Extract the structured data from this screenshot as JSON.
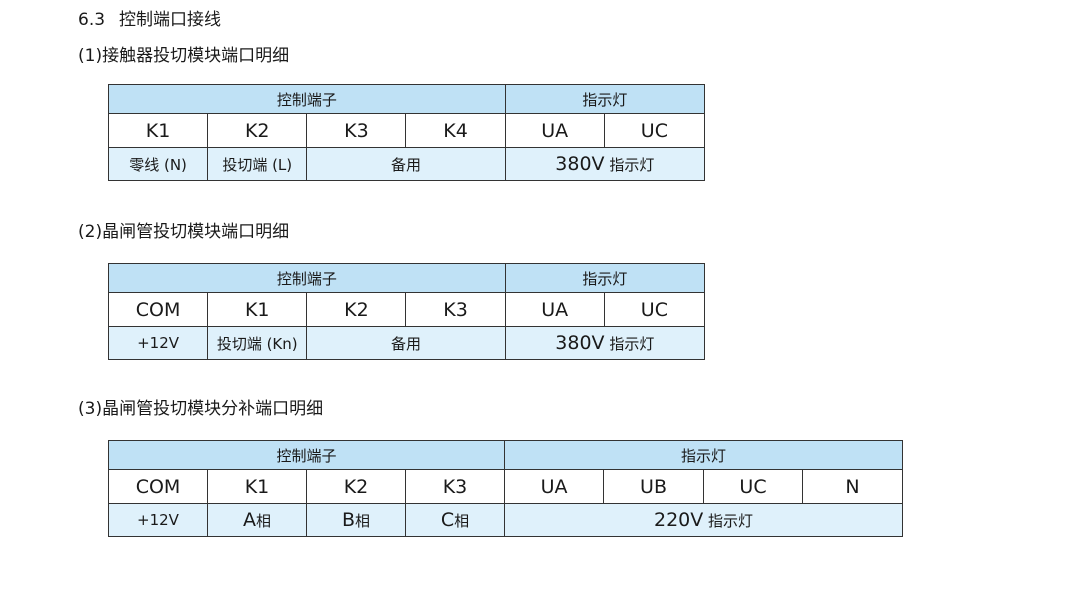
{
  "section": {
    "number": "6.3",
    "title": "控制端口接线"
  },
  "tables": [
    {
      "caption": "(1)接触器投切模块端口明细",
      "group_control": "控制端子",
      "group_indicator": "指示灯",
      "codes": [
        "K1",
        "K2",
        "K3",
        "K4",
        "UA",
        "UC"
      ],
      "desc": {
        "k1": "零线 (N)",
        "k2": "投切端 (L)",
        "spare": "备用",
        "ind_voltage": "380V",
        "ind_label": "指示灯"
      }
    },
    {
      "caption": "(2)晶闸管投切模块端口明细",
      "group_control": "控制端子",
      "group_indicator": "指示灯",
      "codes": [
        "COM",
        "K1",
        "K2",
        "K3",
        "UA",
        "UC"
      ],
      "desc": {
        "com": "+12V",
        "k1": "投切端 (Kn)",
        "spare": "备用",
        "ind_voltage": "380V",
        "ind_label": "指示灯"
      }
    },
    {
      "caption": "(3)晶闸管投切模块分补端口明细",
      "group_control": "控制端子",
      "group_indicator": "指示灯",
      "codes": [
        "COM",
        "K1",
        "K2",
        "K3",
        "UA",
        "UB",
        "UC",
        "N"
      ],
      "desc": {
        "com": "+12V",
        "a_letter": "A",
        "a_phase": "相",
        "b_letter": "B",
        "b_phase": "相",
        "c_letter": "C",
        "c_phase": "相",
        "ind_voltage": "220V",
        "ind_label": "指示灯"
      }
    }
  ]
}
